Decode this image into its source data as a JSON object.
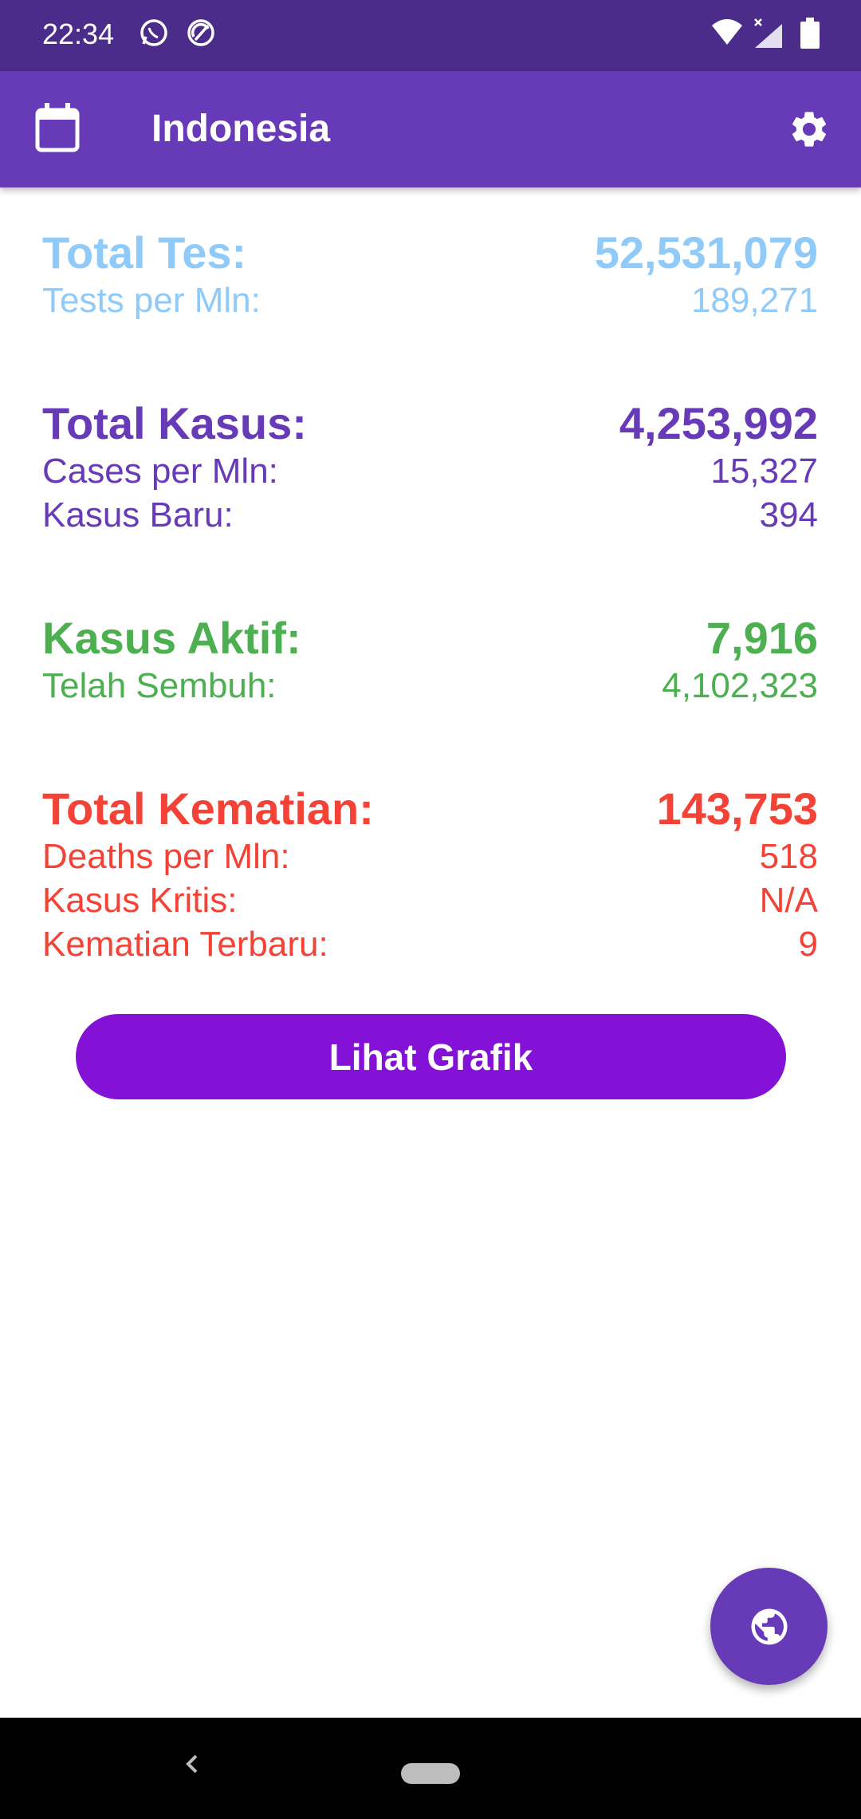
{
  "status_bar": {
    "time": "22:34"
  },
  "app_bar": {
    "title": "Indonesia"
  },
  "tests": {
    "total_label": "Total Tes:",
    "total_value": "52,531,079",
    "per_mln_label": "Tests per Mln:",
    "per_mln_value": "189,271"
  },
  "cases": {
    "total_label": "Total Kasus:",
    "total_value": "4,253,992",
    "per_mln_label": "Cases per Mln:",
    "per_mln_value": "15,327",
    "new_label": "Kasus Baru:",
    "new_value": "394"
  },
  "active": {
    "label": "Kasus Aktif:",
    "value": "7,916",
    "recovered_label": "Telah Sembuh:",
    "recovered_value": "4,102,323"
  },
  "deaths": {
    "total_label": "Total Kematian:",
    "total_value": "143,753",
    "per_mln_label": "Deaths per Mln:",
    "per_mln_value": "518",
    "critical_label": "Kasus Kritis:",
    "critical_value": "N/A",
    "new_label": "Kematian Terbaru:",
    "new_value": "9"
  },
  "chart_button": {
    "label": "Lihat Grafik"
  },
  "colors": {
    "status_bar": "#4b2c8a",
    "app_bar": "#673ab7",
    "tests": "#90caf9",
    "cases": "#673ab7",
    "active": "#4caf50",
    "deaths": "#f44336",
    "button": "#8311d6"
  },
  "icons": [
    "whatsapp-icon",
    "sync-icon",
    "wifi-icon",
    "signal-icon",
    "battery-icon",
    "calendar-icon",
    "gear-icon",
    "globe-icon",
    "back-icon"
  ]
}
